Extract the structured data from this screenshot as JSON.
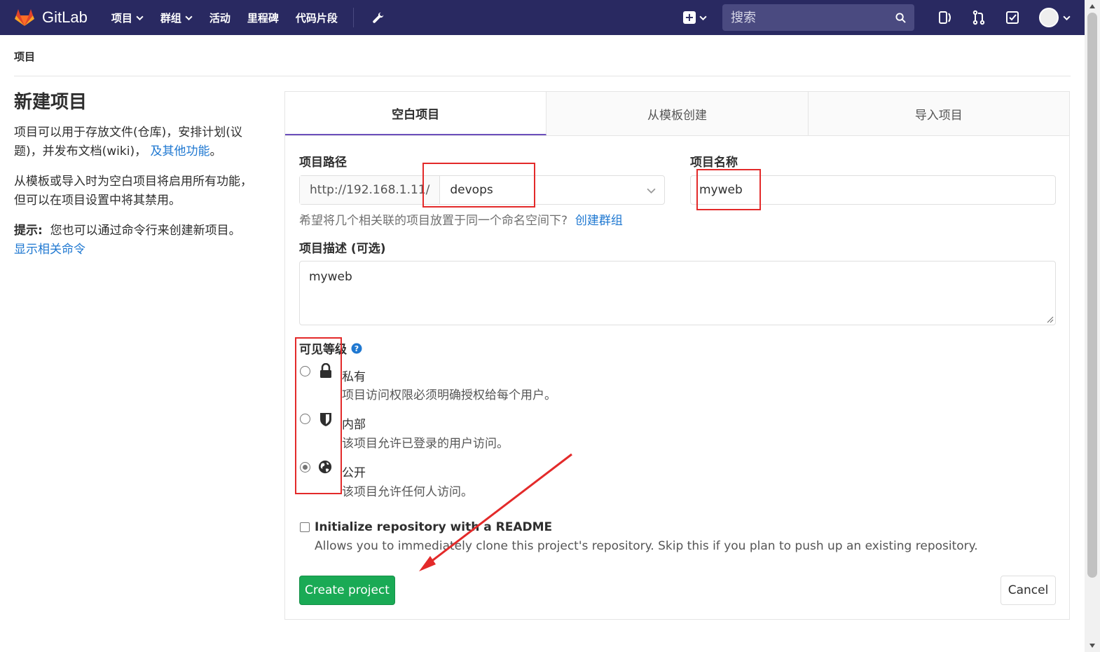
{
  "navbar": {
    "brand": "GitLab",
    "links": [
      {
        "label": "项目",
        "dropdown": true
      },
      {
        "label": "群组",
        "dropdown": true
      },
      {
        "label": "活动",
        "dropdown": false
      },
      {
        "label": "里程碑",
        "dropdown": false
      },
      {
        "label": "代码片段",
        "dropdown": false
      }
    ],
    "search_placeholder": "搜索"
  },
  "breadcrumb": "项目",
  "intro": {
    "title": "新建项目",
    "para1": "项目可以用于存放文件(仓库)，安排计划(议题)，并发布文档(wiki)，",
    "para1_link": "及其他功能",
    "para1_end": "。",
    "para2": "从模板或导入时为空白项目将启用所有功能，但可以在项目设置中将其禁用。",
    "tip_label": "提示:",
    "tip_text": "您也可以通过命令行来创建新项目。",
    "tip_link": "显示相关命令"
  },
  "tabs": [
    {
      "label": "空白项目",
      "active": true
    },
    {
      "label": "从模板创建",
      "active": false
    },
    {
      "label": "导入项目",
      "active": false
    }
  ],
  "form": {
    "path_label": "项目路径",
    "url_prefix": "http://192.168.1.11/",
    "namespace": "devops",
    "name_label": "项目名称",
    "name_value": "myweb",
    "group_hint": "希望将几个相关联的项目放置于同一个命名空间下?",
    "group_hint_link": "创建群组",
    "desc_label": "项目描述 (可选)",
    "desc_value": "myweb",
    "visibility_label": "可见等级",
    "visibility": [
      {
        "title": "私有",
        "desc": "项目访问权限必须明确授权给每个用户。",
        "icon": "lock-icon",
        "checked": false
      },
      {
        "title": "内部",
        "desc": "该项目允许已登录的用户访问。",
        "icon": "shield-icon",
        "checked": false
      },
      {
        "title": "公开",
        "desc": "该项目允许任何人访问。",
        "icon": "globe-icon",
        "checked": true
      }
    ],
    "readme_label": "Initialize repository with a README",
    "readme_help": "Allows you to immediately clone this project's repository. Skip this if you plan to push up an existing repository.",
    "readme_checked": false,
    "create_button": "Create project",
    "cancel_button": "Cancel"
  },
  "colors": {
    "navbar": "#292961",
    "accent": "#6b4fbb",
    "link": "#1f78d1",
    "create": "#1aaa55",
    "annotation": "#e32a2a"
  }
}
